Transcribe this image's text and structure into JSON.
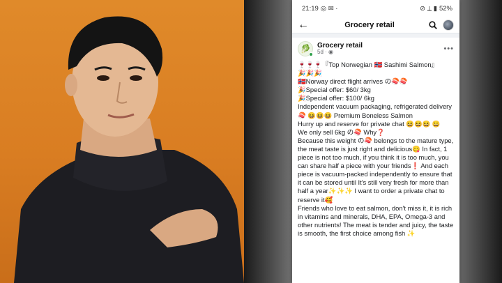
{
  "status_bar": {
    "time": "21:19",
    "left_icons": "◎ ✉ ·",
    "right_icons": "⊘ ⟂ ▮",
    "battery": "52%"
  },
  "app_bar": {
    "title": "Grocery retail"
  },
  "post": {
    "page_name": "Grocery retail",
    "time": "5d · ◉",
    "lines": [
      "🍷🍷🍷『Top Norwegian 🇳🇴 Sashimi Salmon』",
      "🎉🎉🎉",
      "🇳🇴Norway direct flight arrives の🍣🍣",
      "🎉Special offer: $60/ 3kg",
      "🎉Special offer: $100/ 6kg",
      "Independent vacuum packaging, refrigerated delivery",
      "🍣 😆😆😆 Premium Boneless Salmon",
      "Hurry up and reserve for private chat 😆😆😆 😀",
      "We only sell 6kg の🍣 Why❓",
      "Because this weight の🍣 belongs to the mature type, the meat taste is just right and delicious😋 In fact, 1 piece is not too much, if you think it is too much, you can share half a piece with your friends❗ And each piece is vacuum-packed independently to ensure that it can be stored until It's still very fresh for more than half a year✨✨✨ I want to order a private chat to reserve it🥰",
      "Friends who love to eat salmon, don't miss it, it is rich in vitamins and minerals, DHA, EPA, Omega-3 and other nutrients! The meat is tender and juicy, the taste is smooth, the first choice among fish ✨"
    ]
  },
  "colors": {
    "portrait_bg": "#d97d22",
    "sweater": "#1d1d22",
    "online": "#31a24c",
    "muted_text": "#65676b"
  },
  "icons": {
    "back": "arrow-left-icon",
    "search": "search-icon",
    "more": "more-icon",
    "profile": "profile-icon"
  }
}
